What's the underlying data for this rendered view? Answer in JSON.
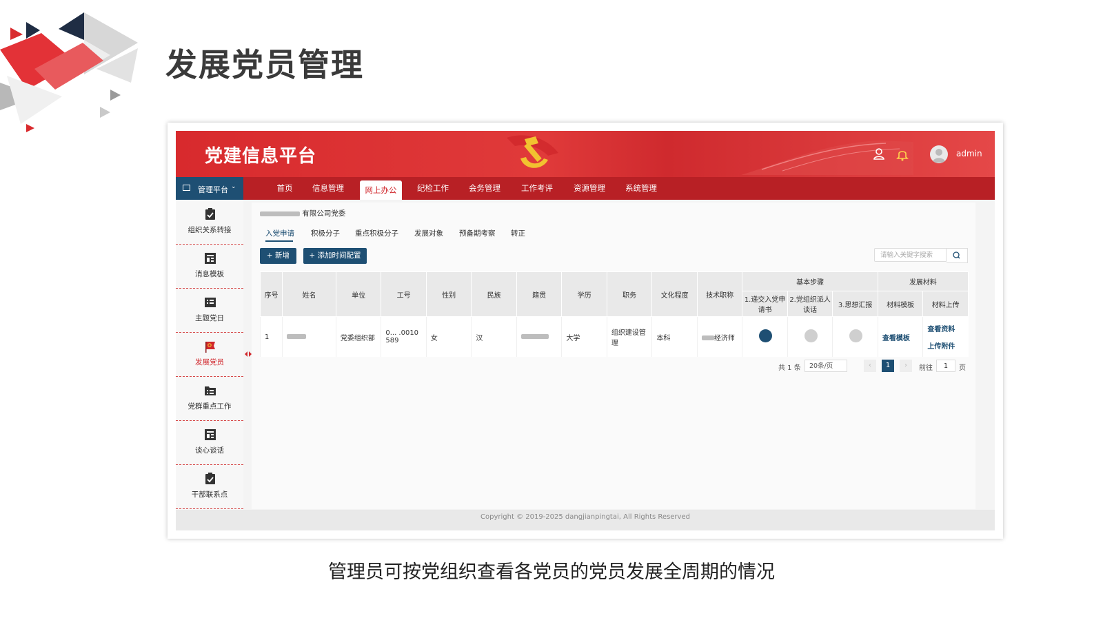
{
  "slide": {
    "title": "发展党员管理",
    "caption": "管理员可按党组织查看各党员的党员发展全周期的情况"
  },
  "header": {
    "brand": "党建信息平台",
    "username": "admin",
    "icons": [
      "user-icon",
      "bell-icon",
      "avatar-icon"
    ]
  },
  "nav": {
    "platform_label": "管理平台",
    "items": [
      {
        "label": "首页"
      },
      {
        "label": "信息管理"
      },
      {
        "label": "网上办公",
        "active": true
      },
      {
        "label": "纪检工作"
      },
      {
        "label": "会务管理"
      },
      {
        "label": "工作考评"
      },
      {
        "label": "资源管理"
      },
      {
        "label": "系统管理"
      }
    ]
  },
  "sidebar": {
    "items": [
      {
        "label": "组织关系转接",
        "icon": "clipboard-check-icon"
      },
      {
        "label": "消息模板",
        "icon": "template-icon"
      },
      {
        "label": "主题党日",
        "icon": "list-icon"
      },
      {
        "label": "发展党员",
        "icon": "party-flag-icon",
        "active": true
      },
      {
        "label": "党群重点工作",
        "icon": "folder-list-icon"
      },
      {
        "label": "谈心谈话",
        "icon": "template-icon"
      },
      {
        "label": "干部联系点",
        "icon": "clipboard-check-icon"
      }
    ]
  },
  "content": {
    "breadcrumb": "有限公司党委",
    "tabs": [
      {
        "label": "入党申请",
        "active": true
      },
      {
        "label": "积极分子"
      },
      {
        "label": "重点积极分子"
      },
      {
        "label": "发展对象"
      },
      {
        "label": "预备期考察"
      },
      {
        "label": "转正"
      }
    ],
    "buttons": {
      "add": "+ 新增",
      "add_time_config": "+ 添加时间配置"
    },
    "search_placeholder": "请输入关键字搜索"
  },
  "table": {
    "headers": [
      "序号",
      "姓名",
      "单位",
      "工号",
      "性别",
      "民族",
      "籍贯",
      "学历",
      "职务",
      "文化程度",
      "技术职称"
    ],
    "group_headers": {
      "steps": "基本步骤",
      "materials": "发展材料"
    },
    "step_headers": [
      "1.递交入党申请书",
      "2.党组织派人谈话",
      "3.思想汇报"
    ],
    "material_headers": [
      "材料模板",
      "材料上传"
    ],
    "rows": [
      {
        "index": "1",
        "unit": "党委组织部",
        "job_no": "0... .0010 589",
        "gender": "女",
        "ethnicity": "汉",
        "education": "大学",
        "position": "组织建设管理",
        "culture": "本科",
        "title_suffix": "经济师",
        "steps": [
          "done",
          "pending",
          "pending"
        ],
        "template_link": "查看模板",
        "view_link": "查看资料",
        "upload_link": "上传附件"
      }
    ],
    "colors": {
      "done": "#1e4f73",
      "pending": "#cfcfcf"
    }
  },
  "pagination": {
    "total": "共 1 条",
    "page_size": "20条/页",
    "current_page": "1",
    "goto_label": "前往",
    "goto_value": "1",
    "page_unit": "页"
  },
  "footer": {
    "copyright": "Copyright © 2019-2025 dangjianpingtai, All Rights Reserved"
  },
  "colors": {
    "brand_red": "#d82a2d",
    "nav_red": "#b82025",
    "navy": "#1e4f73"
  }
}
